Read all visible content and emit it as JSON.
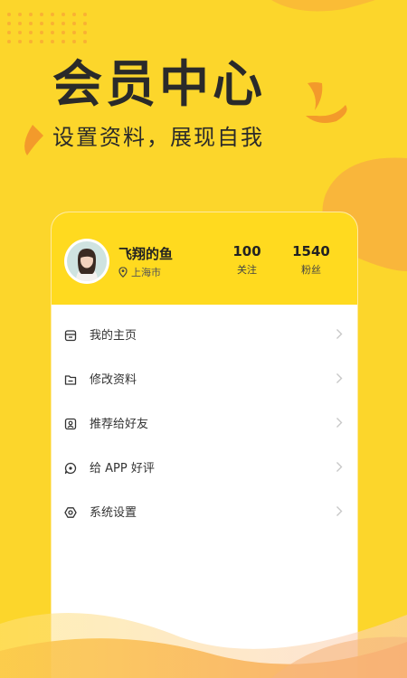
{
  "hero": {
    "title": "会员中心",
    "subtitle": "设置资料，展现自我"
  },
  "profile": {
    "name": "飞翔的鱼",
    "location": "上海市",
    "following_count": "100",
    "following_label": "关注",
    "fans_count": "1540",
    "fans_label": "粉丝"
  },
  "menu": {
    "items": [
      {
        "label": "我的主页",
        "icon": "home-icon"
      },
      {
        "label": "修改资料",
        "icon": "folder-icon"
      },
      {
        "label": "推荐给好友",
        "icon": "share-contact-icon"
      },
      {
        "label": "给 APP 好评",
        "icon": "comment-heart-icon"
      },
      {
        "label": "系统设置",
        "icon": "settings-icon"
      }
    ]
  },
  "colors": {
    "background": "#FCD62B",
    "card_header": "#FFDA1F",
    "accent_orange": "#F7A23A",
    "text_dark": "#2A2A2A"
  }
}
